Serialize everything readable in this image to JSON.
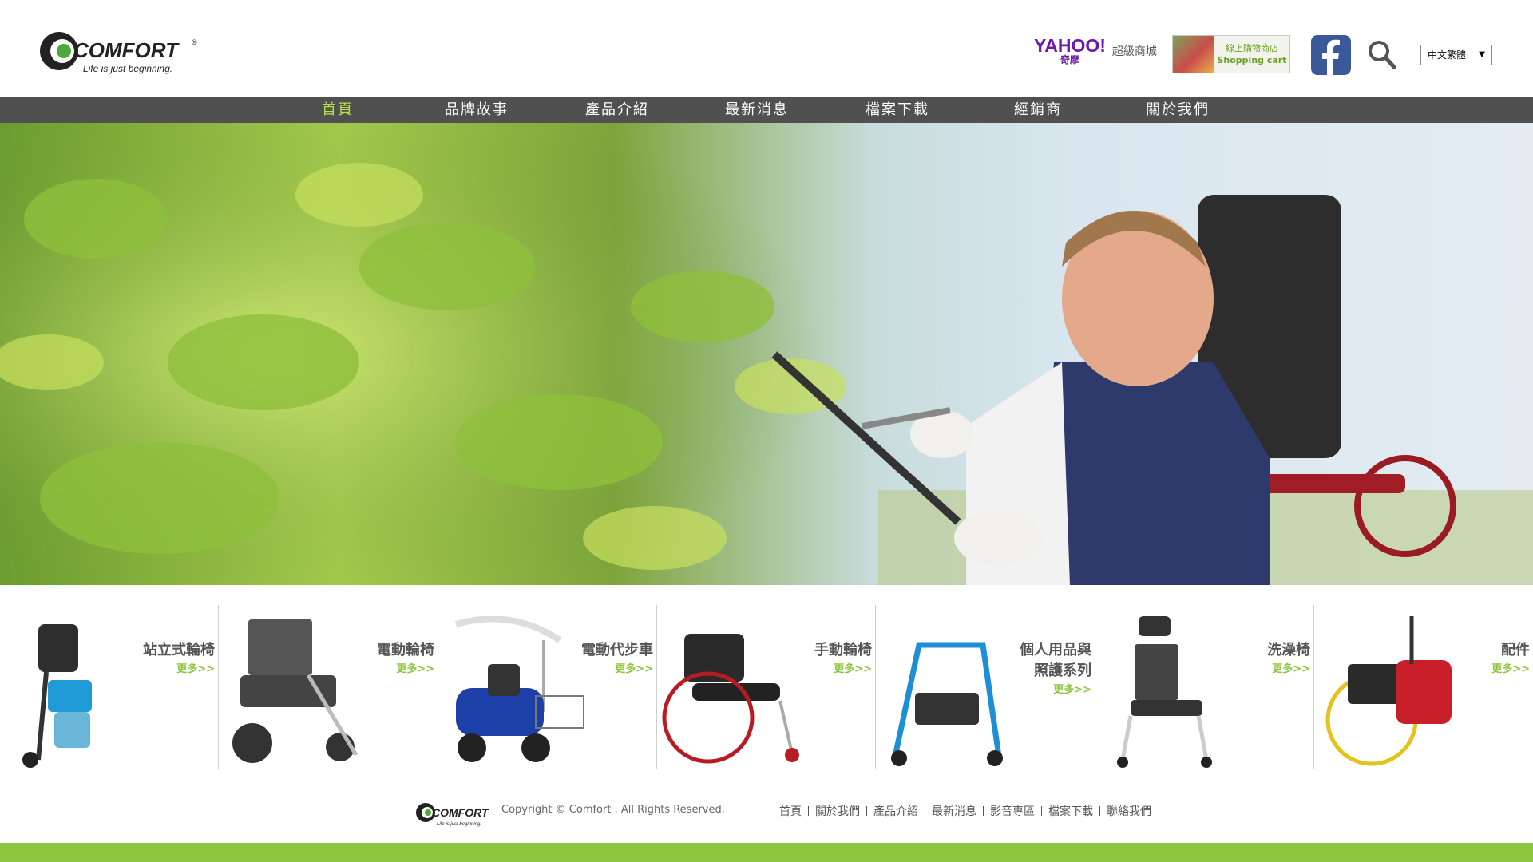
{
  "brand": {
    "name": "COMFORT",
    "registered": "®",
    "tagline": "Life is just beginning."
  },
  "header": {
    "yahoo_logo": "YAHOO!",
    "yahoo_sub": "奇摩",
    "yahoo_mall": "超級商城",
    "shop_text_zh": "線上購物商店",
    "shop_text_en": "Shopping cart",
    "language": "中文繁體"
  },
  "nav": {
    "items": [
      {
        "label": "首頁",
        "active": true
      },
      {
        "label": "品牌故事",
        "active": false
      },
      {
        "label": "產品介紹",
        "active": false
      },
      {
        "label": "最新消息",
        "active": false
      },
      {
        "label": "檔案下載",
        "active": false
      },
      {
        "label": "經銷商",
        "active": false
      },
      {
        "label": "關於我們",
        "active": false
      }
    ]
  },
  "categories": [
    {
      "label": "站立式輪椅",
      "more": "更多>>",
      "icon": "standing-wheelchair"
    },
    {
      "label": "電動輪椅",
      "more": "更多>>",
      "icon": "power-wheelchair"
    },
    {
      "label": "電動代步車",
      "more": "更多>>",
      "icon": "mobility-scooter"
    },
    {
      "label": "手動輪椅",
      "more": "更多>>",
      "icon": "manual-wheelchair"
    },
    {
      "label": "個人用品與\n照護系列",
      "more": "更多>>",
      "icon": "rollator"
    },
    {
      "label": "洗澡椅",
      "more": "更多>>",
      "icon": "shower-chair"
    },
    {
      "label": "配件",
      "more": "更多>>",
      "icon": "accessories"
    }
  ],
  "footer": {
    "copyright": "Copyright © Comfort . All Rights Reserved.",
    "links": [
      "首頁",
      "關於我們",
      "產品介紹",
      "最新消息",
      "影音專區",
      "檔案下載",
      "聯絡我們"
    ]
  },
  "colors": {
    "nav_bg": "#505050",
    "accent_green": "#8cc63f",
    "active_nav": "#b6e04a",
    "facebook": "#3b5998",
    "yahoo": "#6c1aa8"
  }
}
